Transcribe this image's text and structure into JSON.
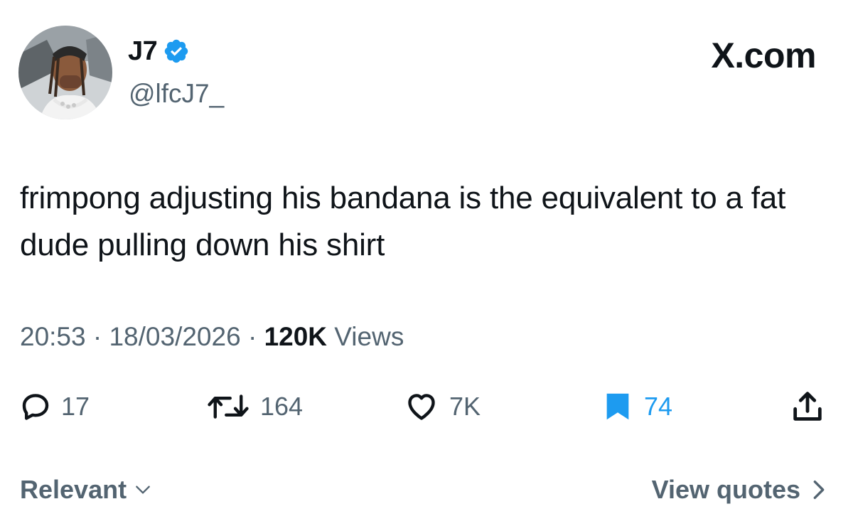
{
  "author": {
    "display_name": "J7",
    "handle": "@lfcJ7_",
    "verified": true
  },
  "site_label": "X.com",
  "tweet": {
    "text": "frimpong adjusting his bandana is the equivalent to a fat dude pulling down his shirt"
  },
  "meta": {
    "time": "20:53",
    "separator": "·",
    "date": "18/03/2026",
    "views_count": "120K",
    "views_label": "Views"
  },
  "actions": {
    "replies": "17",
    "reposts": "164",
    "likes": "7K",
    "bookmarks": "74"
  },
  "footer": {
    "sort_label": "Relevant",
    "view_quotes_label": "View quotes"
  },
  "colors": {
    "text_primary": "#0f1419",
    "text_secondary": "#536471",
    "accent_blue": "#1d9bf0"
  }
}
